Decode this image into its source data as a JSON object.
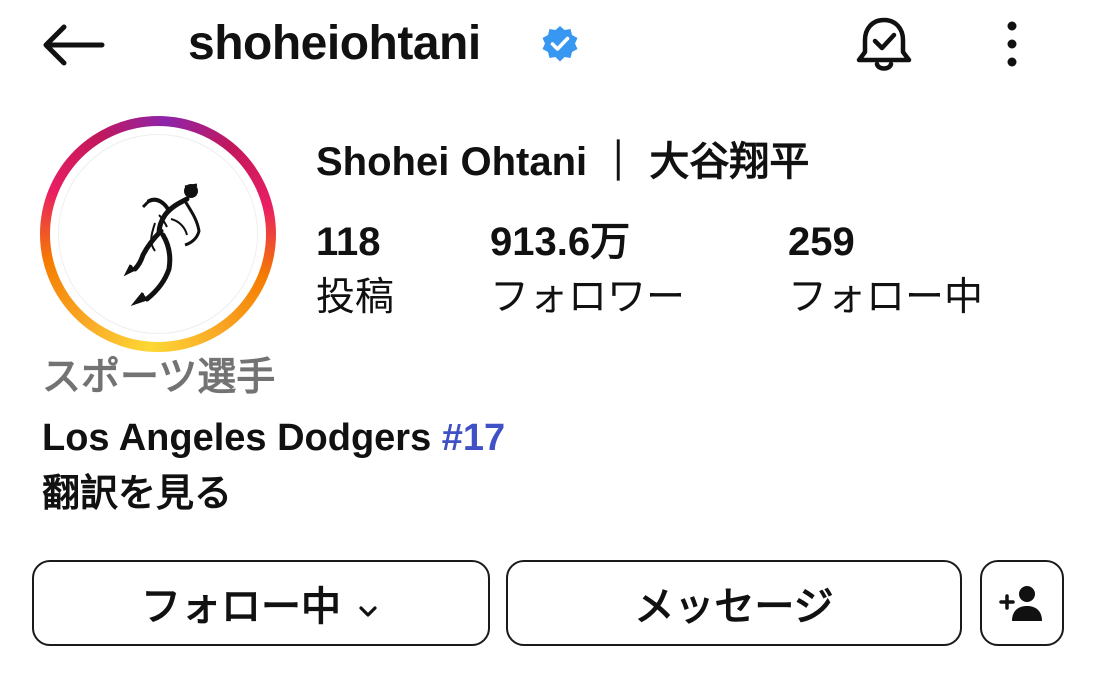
{
  "header": {
    "username": "shoheiohtani",
    "back_icon": "arrow-left-icon",
    "verified_icon": "verified-badge-icon",
    "bell_icon": "bell-check-icon",
    "more_icon": "more-vertical-icon"
  },
  "profile": {
    "full_name": "Shohei Ohtani ｜ 大谷翔平",
    "avatar_icon": "baseball-player-sketch",
    "stats": [
      {
        "value": "118",
        "label": "投稿"
      },
      {
        "value": "913.6万",
        "label": "フォロワー"
      },
      {
        "value": "259",
        "label": "フォロー中"
      }
    ],
    "category": "スポーツ選手",
    "bio_text": "Los Angeles Dodgers ",
    "bio_hashtag": "#17",
    "translate_label": "翻訳を見る"
  },
  "actions": {
    "following_label": "フォロー中",
    "message_label": "メッセージ",
    "suggest_icon": "person-add-icon"
  },
  "colors": {
    "verified": "#3897f0",
    "hashtag": "#3f51c5",
    "category": "#737373"
  }
}
